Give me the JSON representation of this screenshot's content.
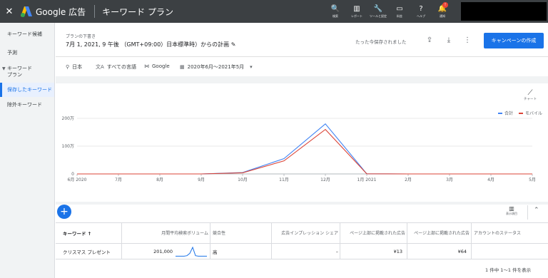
{
  "header": {
    "close_glyph": "✕",
    "brand": "Google 広告",
    "page_name": "キーワード プラン",
    "icons": [
      {
        "name": "search-icon",
        "glyph": "🔍",
        "label": "検索"
      },
      {
        "name": "report-icon",
        "glyph": "▥",
        "label": "レポート"
      },
      {
        "name": "tools-icon",
        "glyph": "🔧",
        "label": "ツールと設定"
      },
      {
        "name": "billing-icon",
        "glyph": "▭",
        "label": "料金"
      },
      {
        "name": "help-icon",
        "glyph": "?",
        "label": "ヘルプ"
      },
      {
        "name": "bell-icon",
        "glyph": "🔔",
        "label": "通知"
      }
    ],
    "notif_count": "!"
  },
  "sidebar": {
    "items": [
      {
        "label": "キーワード候補"
      },
      {
        "label": "予測"
      },
      {
        "label": "キーワード\nプラン"
      },
      {
        "label": "保存したキーワード"
      },
      {
        "label": "除外キーワード"
      }
    ]
  },
  "plan": {
    "subtitle": "プランの下書き",
    "title": "7月 1, 2021, 9 午後 （GMT+09:00）日本標準時）からの計画",
    "saved_status": "たった今保存されました",
    "create_button": "キャンペーンの作成"
  },
  "filters": {
    "location": "日本",
    "language": "すべての言語",
    "network": "Google",
    "date_range": "2020年6月～2021年5月"
  },
  "chart_tool_label": "チャート",
  "columns_tool_label": "表示項目",
  "chart_data": {
    "type": "line",
    "x": [
      "6月 2020",
      "7月",
      "8月",
      "9月",
      "10月",
      "11月",
      "12月",
      "1月 2021",
      "2月",
      "3月",
      "4月",
      "5月"
    ],
    "y_ticks": [
      "0",
      "100万",
      "200万"
    ],
    "ylim": [
      0,
      2000000
    ],
    "series": [
      {
        "name": "合計",
        "color": "#4285f4",
        "values": [
          0,
          0,
          0,
          0,
          50000,
          550000,
          1800000,
          5000,
          0,
          0,
          0,
          0
        ]
      },
      {
        "name": "モバイル",
        "color": "#db4437",
        "values": [
          0,
          0,
          0,
          0,
          40000,
          470000,
          1600000,
          4000,
          0,
          0,
          0,
          0
        ]
      }
    ],
    "legend_position": "top-right"
  },
  "table": {
    "headers": [
      "キーワード ↑",
      "月間平均検索ボリューム",
      "競合性",
      "広告インプレッション シェア",
      "ページ上部に掲載された広告",
      "ページ上部に掲載された広告",
      "アカウントのステータス"
    ],
    "rows": [
      {
        "keyword": "クリスマス プレゼント",
        "volume": "201,000",
        "competition": "高",
        "impression_share": "–",
        "top_low": "¥13",
        "top_high": "¥64",
        "status": ""
      }
    ],
    "sparkline": [
      0.05,
      0.05,
      0.05,
      0.05,
      0.1,
      0.35,
      1.0,
      0.1,
      0.05,
      0.05,
      0.05,
      0.05
    ],
    "pagination": "1 件中 1～1 件を表示"
  }
}
